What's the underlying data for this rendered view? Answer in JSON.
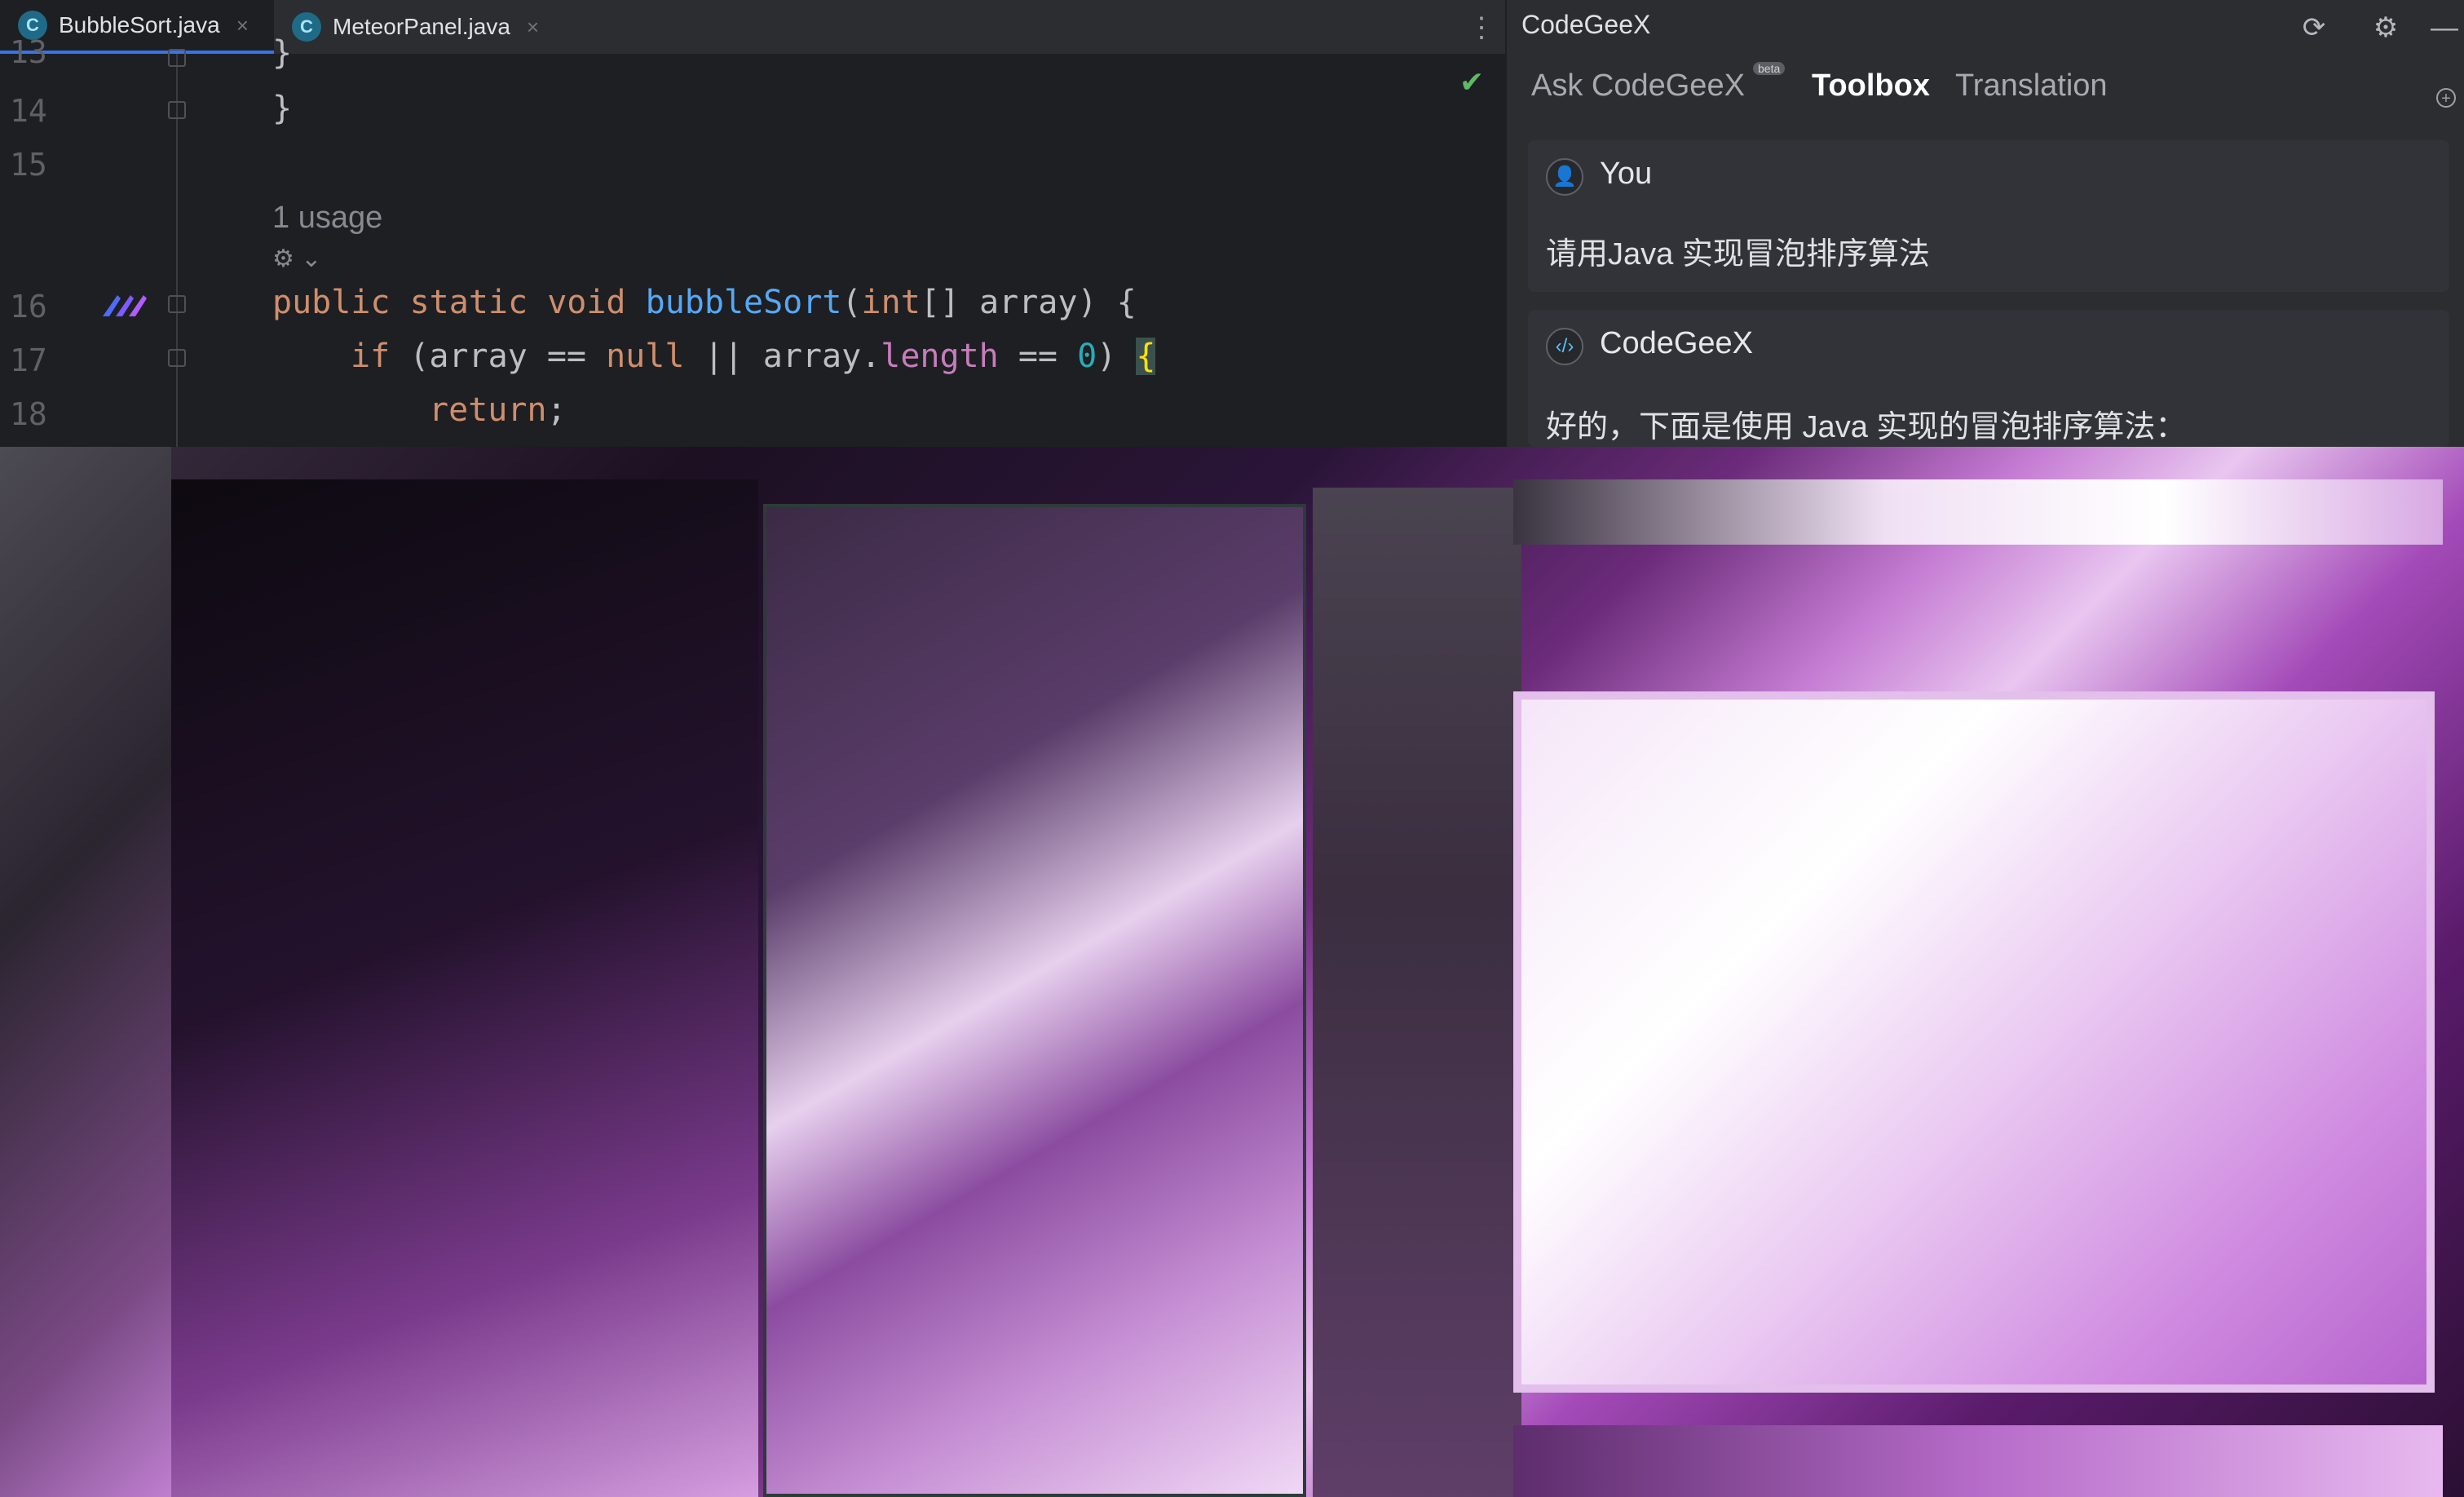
{
  "editor": {
    "tabs": [
      {
        "name": "BubbleSort.java",
        "icon": "C"
      },
      {
        "name": "MeteorPanel.java",
        "icon": "C"
      }
    ],
    "line_numbers": [
      "13",
      "14",
      "15",
      "16",
      "17",
      "18"
    ],
    "usage_hint": "1 usage",
    "code_lines": {
      "l13": "}",
      "l14": "}",
      "l16": {
        "kw1": "public",
        "kw2": "static",
        "kw3": "void",
        "fn": "bubbleSort",
        "kw4": "int",
        "rest": "[] array) {"
      },
      "l17": {
        "kw1": "if",
        "p1": " (array == ",
        "kw2": "null",
        "p2": " || array.",
        "fld": "length",
        "p3": " == ",
        "num": "0",
        "p4": ") ",
        "brace": "{"
      },
      "l18": {
        "kw1": "return",
        "p1": ";"
      }
    }
  },
  "panel": {
    "title": "CodeGeeX",
    "tabs": [
      "Ask CodeGeeX",
      "Toolbox",
      "Translation"
    ],
    "beta_badge": "beta",
    "messages": [
      {
        "sender": "You",
        "text": "请用Java 实现冒泡排序算法"
      },
      {
        "sender": "CodeGeeX",
        "text": "好的，下面是使用 Java 实现的冒泡排序算法："
      }
    ]
  },
  "colors": {
    "accent": "#3574f0",
    "keyword": "#cf8e6d",
    "function": "#56a8f5",
    "field": "#c77dbb",
    "number": "#2aacb8",
    "check": "#5fb865"
  }
}
